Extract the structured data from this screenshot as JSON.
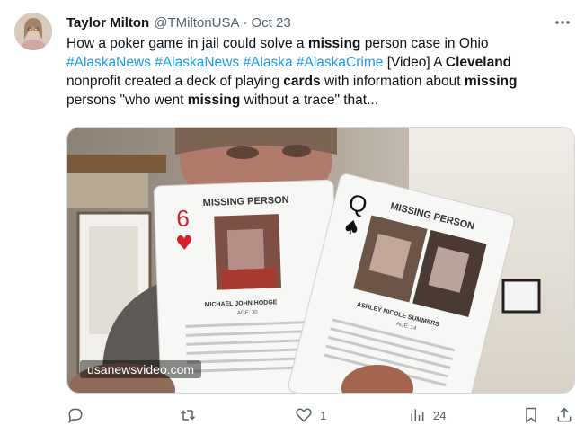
{
  "author": {
    "name": "Taylor Milton",
    "handle": "@TMiltonUSA",
    "separator": "·",
    "date": "Oct 23"
  },
  "tweet": {
    "t1": "How a poker game in jail could solve a ",
    "t2": "missing",
    "t3": " person case in Ohio",
    "hashtags": [
      "#AlaskaNews",
      "#AlaskaNews",
      "#Alaska",
      "#AlaskaCrime"
    ],
    "t4": " [Video] A ",
    "t5": "Cleveland",
    "t6": " nonprofit created a deck of playing ",
    "t7": "cards",
    "t8": " with information about ",
    "t9": "missing",
    "t10": " persons \"who went ",
    "t11": "missing",
    "t12": " without a trace\" that..."
  },
  "media": {
    "watermark": "usanewsvideo.com",
    "card1": {
      "rank": "6",
      "suit": "♥",
      "title": "MISSING PERSON",
      "name": "MICHAEL JOHN HODGE",
      "age": "AGE: 30"
    },
    "card2": {
      "rank": "Q",
      "suit": "♠",
      "title": "MISSING PERSON",
      "name": "ASHLEY NICOLE SUMMERS",
      "age": "AGE: 14"
    }
  },
  "actions": {
    "reply_count": "",
    "retweet_count": "",
    "like_count": "1",
    "views_count": "24"
  },
  "icons": [
    "more-icon",
    "reply-icon",
    "retweet-icon",
    "like-icon",
    "views-icon",
    "bookmark-icon",
    "share-icon"
  ],
  "colors": {
    "link": "#1d9bf0",
    "muted": "#536471",
    "text": "#0f1419",
    "heart_suit": "#d3202b"
  }
}
